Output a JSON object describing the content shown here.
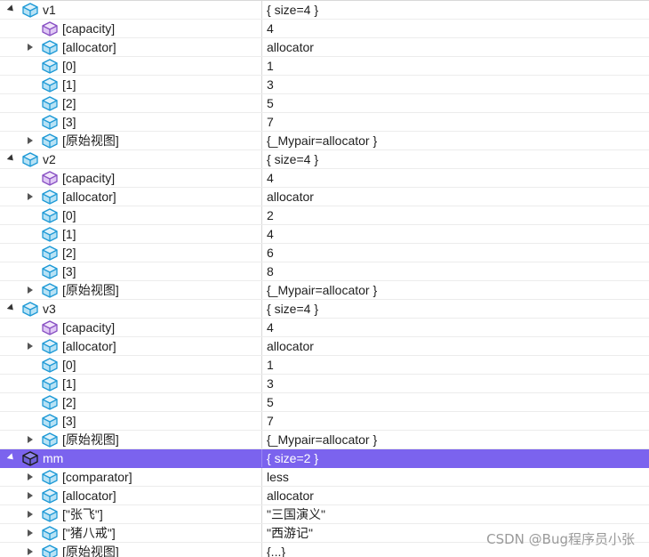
{
  "rows": [
    {
      "depth": 0,
      "exp": "down",
      "icon": "object",
      "name": "v1",
      "value": "{ size=4 }"
    },
    {
      "depth": 1,
      "exp": "",
      "icon": "field",
      "name": "[capacity]",
      "value": "4"
    },
    {
      "depth": 1,
      "exp": "right",
      "icon": "object",
      "name": "[allocator]",
      "value": "allocator"
    },
    {
      "depth": 1,
      "exp": "",
      "icon": "object",
      "name": "[0]",
      "value": "1"
    },
    {
      "depth": 1,
      "exp": "",
      "icon": "object",
      "name": "[1]",
      "value": "3"
    },
    {
      "depth": 1,
      "exp": "",
      "icon": "object",
      "name": "[2]",
      "value": "5"
    },
    {
      "depth": 1,
      "exp": "",
      "icon": "object",
      "name": "[3]",
      "value": "7"
    },
    {
      "depth": 1,
      "exp": "right",
      "icon": "object",
      "name": "[原始视图]",
      "value": "{_Mypair=allocator }"
    },
    {
      "depth": 0,
      "exp": "down",
      "icon": "object",
      "name": "v2",
      "value": "{ size=4 }"
    },
    {
      "depth": 1,
      "exp": "",
      "icon": "field",
      "name": "[capacity]",
      "value": "4"
    },
    {
      "depth": 1,
      "exp": "right",
      "icon": "object",
      "name": "[allocator]",
      "value": "allocator"
    },
    {
      "depth": 1,
      "exp": "",
      "icon": "object",
      "name": "[0]",
      "value": "2"
    },
    {
      "depth": 1,
      "exp": "",
      "icon": "object",
      "name": "[1]",
      "value": "4"
    },
    {
      "depth": 1,
      "exp": "",
      "icon": "object",
      "name": "[2]",
      "value": "6"
    },
    {
      "depth": 1,
      "exp": "",
      "icon": "object",
      "name": "[3]",
      "value": "8"
    },
    {
      "depth": 1,
      "exp": "right",
      "icon": "object",
      "name": "[原始视图]",
      "value": "{_Mypair=allocator }"
    },
    {
      "depth": 0,
      "exp": "down",
      "icon": "object",
      "name": "v3",
      "value": "{ size=4 }"
    },
    {
      "depth": 1,
      "exp": "",
      "icon": "field",
      "name": "[capacity]",
      "value": "4"
    },
    {
      "depth": 1,
      "exp": "right",
      "icon": "object",
      "name": "[allocator]",
      "value": "allocator"
    },
    {
      "depth": 1,
      "exp": "",
      "icon": "object",
      "name": "[0]",
      "value": "1"
    },
    {
      "depth": 1,
      "exp": "",
      "icon": "object",
      "name": "[1]",
      "value": "3"
    },
    {
      "depth": 1,
      "exp": "",
      "icon": "object",
      "name": "[2]",
      "value": "5"
    },
    {
      "depth": 1,
      "exp": "",
      "icon": "object",
      "name": "[3]",
      "value": "7"
    },
    {
      "depth": 1,
      "exp": "right",
      "icon": "object",
      "name": "[原始视图]",
      "value": "{_Mypair=allocator }"
    },
    {
      "depth": 0,
      "exp": "down",
      "icon": "object-dark",
      "name": "mm",
      "value": "{ size=2 }",
      "selected": true
    },
    {
      "depth": 1,
      "exp": "right",
      "icon": "object",
      "name": "[comparator]",
      "value": "less"
    },
    {
      "depth": 1,
      "exp": "right",
      "icon": "object",
      "name": "[allocator]",
      "value": "allocator"
    },
    {
      "depth": 1,
      "exp": "right",
      "icon": "object",
      "name": "[\"张飞\"]",
      "value": "\"三国演义\""
    },
    {
      "depth": 1,
      "exp": "right",
      "icon": "object",
      "name": "[\"猪八戒\"]",
      "value": "\"西游记\""
    },
    {
      "depth": 1,
      "exp": "right",
      "icon": "object",
      "name": "[原始视图]",
      "value": "{...}"
    }
  ],
  "watermark": "CSDN @Bug程序员小张",
  "colors": {
    "selection": "#7b63ee",
    "icon_blue": "#1f9ad6",
    "icon_purple": "#8a52c4"
  }
}
